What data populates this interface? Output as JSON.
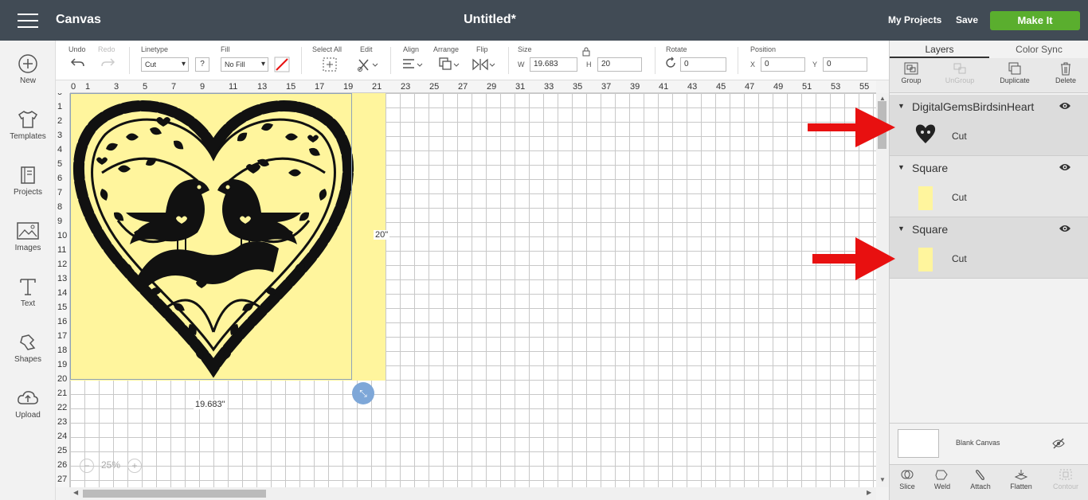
{
  "header": {
    "app_title": "Canvas",
    "doc_title": "Untitled*",
    "my_projects": "My Projects",
    "save": "Save",
    "make_it": "Make It"
  },
  "leftbar": [
    {
      "label": "New",
      "icon": "plus-circle-icon"
    },
    {
      "label": "Templates",
      "icon": "shirt-icon"
    },
    {
      "label": "Projects",
      "icon": "book-icon"
    },
    {
      "label": "Images",
      "icon": "image-icon"
    },
    {
      "label": "Text",
      "icon": "text-icon"
    },
    {
      "label": "Shapes",
      "icon": "shapes-icon"
    },
    {
      "label": "Upload",
      "icon": "upload-icon"
    }
  ],
  "toolbar": {
    "undo": "Undo",
    "redo": "Redo",
    "linetype_label": "Linetype",
    "linetype_value": "Cut",
    "help": "?",
    "fill_label": "Fill",
    "fill_value": "No Fill",
    "select_all": "Select All",
    "edit": "Edit",
    "align": "Align",
    "arrange": "Arrange",
    "flip": "Flip",
    "size_label": "Size",
    "w_label": "W",
    "w_value": "19.683",
    "h_label": "H",
    "h_value": "20",
    "rotate_label": "Rotate",
    "rotate_value": "0",
    "position_label": "Position",
    "x_label": "X",
    "x_value": "0",
    "y_label": "Y",
    "y_value": "0"
  },
  "ruler": {
    "x_ticks": [
      "0",
      "1",
      "3",
      "5",
      "7",
      "9",
      "11",
      "13",
      "15",
      "17",
      "19",
      "21",
      "23",
      "25",
      "27",
      "29",
      "31",
      "33",
      "35",
      "37",
      "39",
      "41",
      "43",
      "45",
      "47",
      "49",
      "51",
      "53",
      "55"
    ],
    "y_ticks": [
      "0",
      "1",
      "2",
      "3",
      "4",
      "5",
      "6",
      "7",
      "8",
      "9",
      "10",
      "11",
      "12",
      "13",
      "14",
      "15",
      "16",
      "17",
      "18",
      "19",
      "20",
      "21",
      "22",
      "23",
      "24",
      "25",
      "26",
      "27"
    ]
  },
  "canvas": {
    "height_dim": "20\"",
    "width_dim": "19.683\"",
    "zoom_minus": "−",
    "zoom": "25%",
    "zoom_plus": "+",
    "square_color": "#fff59d"
  },
  "panel": {
    "tab_layers": "Layers",
    "tab_color_sync": "Color Sync",
    "tools": [
      {
        "label": "Group",
        "enabled": true,
        "icon": "group-icon"
      },
      {
        "label": "UnGroup",
        "enabled": false,
        "icon": "ungroup-icon"
      },
      {
        "label": "Duplicate",
        "enabled": true,
        "icon": "duplicate-icon"
      },
      {
        "label": "Delete",
        "enabled": true,
        "icon": "trash-icon"
      }
    ],
    "layers": [
      {
        "name": "DigitalGemsBirdsinHeart",
        "op": "Cut"
      },
      {
        "name": "Square",
        "op": "Cut"
      },
      {
        "name": "Square",
        "op": "Cut"
      }
    ],
    "blank_canvas": "Blank Canvas",
    "bottom_tools": [
      {
        "label": "Slice",
        "enabled": true,
        "icon": "slice-icon"
      },
      {
        "label": "Weld",
        "enabled": true,
        "icon": "weld-icon"
      },
      {
        "label": "Attach",
        "enabled": true,
        "icon": "paperclip-icon"
      },
      {
        "label": "Flatten",
        "enabled": true,
        "icon": "flatten-icon"
      },
      {
        "label": "Contour",
        "enabled": false,
        "icon": "contour-icon"
      }
    ]
  },
  "colors": {
    "topbar": "#414b55",
    "make_it": "#5aae2e",
    "arrow": "#e81010"
  }
}
